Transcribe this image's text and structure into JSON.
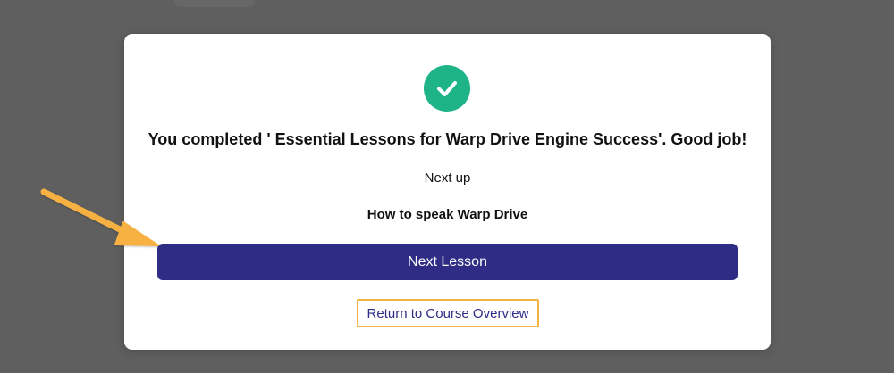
{
  "dialog": {
    "status_icon": "checkmark-circle-icon",
    "completed_message": "You completed ' Essential Lessons for Warp Drive Engine Success'. Good job!",
    "next_up_label": "Next up",
    "next_lesson_title": "How to speak Warp Drive",
    "next_button_label": "Next Lesson",
    "return_link_label": "Return to Course Overview"
  },
  "annotation": {
    "arrow_icon": "arrow-pointer-icon",
    "highlight_color": "#f5b441"
  },
  "colors": {
    "success": "#1fb488",
    "primary": "#2e2c84",
    "backdrop": "#5f5f5f",
    "surface": "#ffffff"
  }
}
